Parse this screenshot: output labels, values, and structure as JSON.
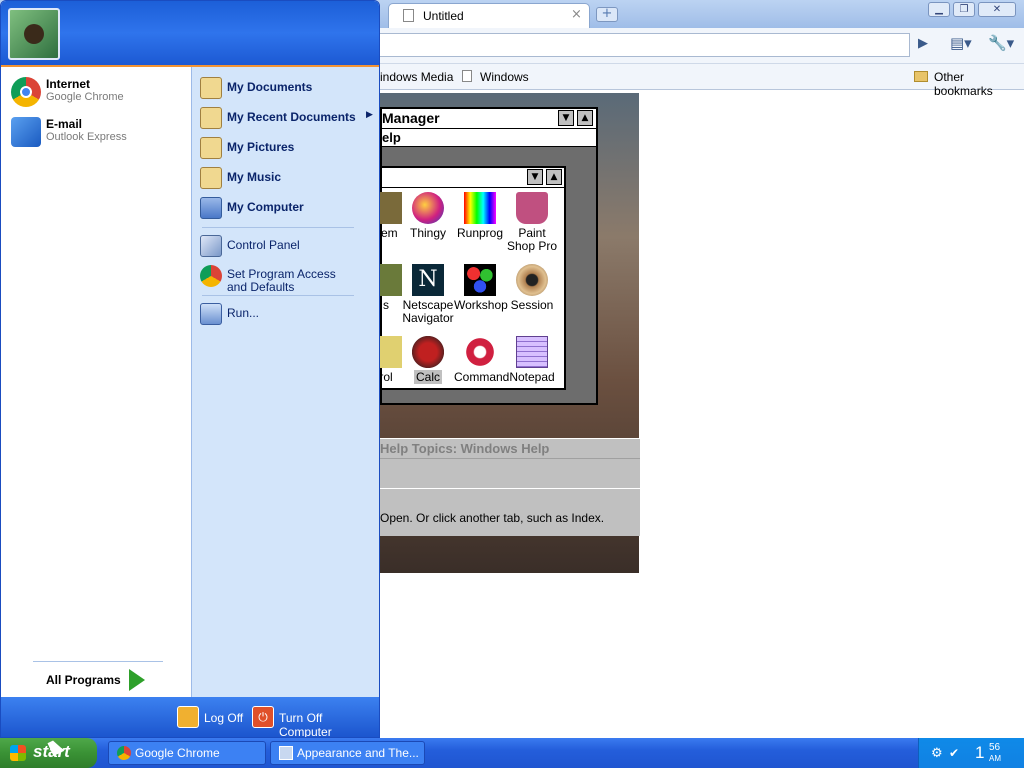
{
  "browser": {
    "tab_title": "Untitled",
    "tab_close": "×",
    "new_tab": "+",
    "bookmarks": [
      "indows Media",
      "Windows"
    ],
    "other_bookmarks": "Other bookmarks"
  },
  "win31": {
    "progman_title": "Manager",
    "progman_menu": "elp",
    "icons_row1": [
      "hem",
      "Thingy",
      "Runprog",
      "Paint Shop Pro"
    ],
    "icons_row2": [
      "s",
      "Netscape Navigator",
      "Workshop",
      "Session"
    ],
    "icons_row3": [
      "rol",
      "Calc",
      "Command",
      "Notepad"
    ],
    "help_title": "Help Topics: Windows Help",
    "help_text": "Open. Or click another tab, such as Index."
  },
  "start_menu": {
    "pinned": [
      {
        "name": "Internet",
        "sub": "Google Chrome"
      },
      {
        "name": "E-mail",
        "sub": "Outlook Express"
      }
    ],
    "all_programs": "All Programs",
    "right_items_bold": [
      "My Documents",
      "My Recent Documents",
      "My Pictures",
      "My Music",
      "My Computer"
    ],
    "right_items": [
      "Control Panel",
      "Set Program Access and Defaults"
    ],
    "run": "Run...",
    "log_off": "Log Off",
    "turn_off": "Turn Off Computer"
  },
  "taskbar": {
    "start": "start",
    "tasks": [
      "Google Chrome",
      "Appearance and The..."
    ],
    "clock_hour": "1",
    "clock_min": "56",
    "clock_ampm": "AM"
  },
  "colors": {
    "start_header": "#2f74ec",
    "taskbar": "#245edb",
    "start_button": "#3a9235",
    "right_pane": "#d3e5fa"
  }
}
